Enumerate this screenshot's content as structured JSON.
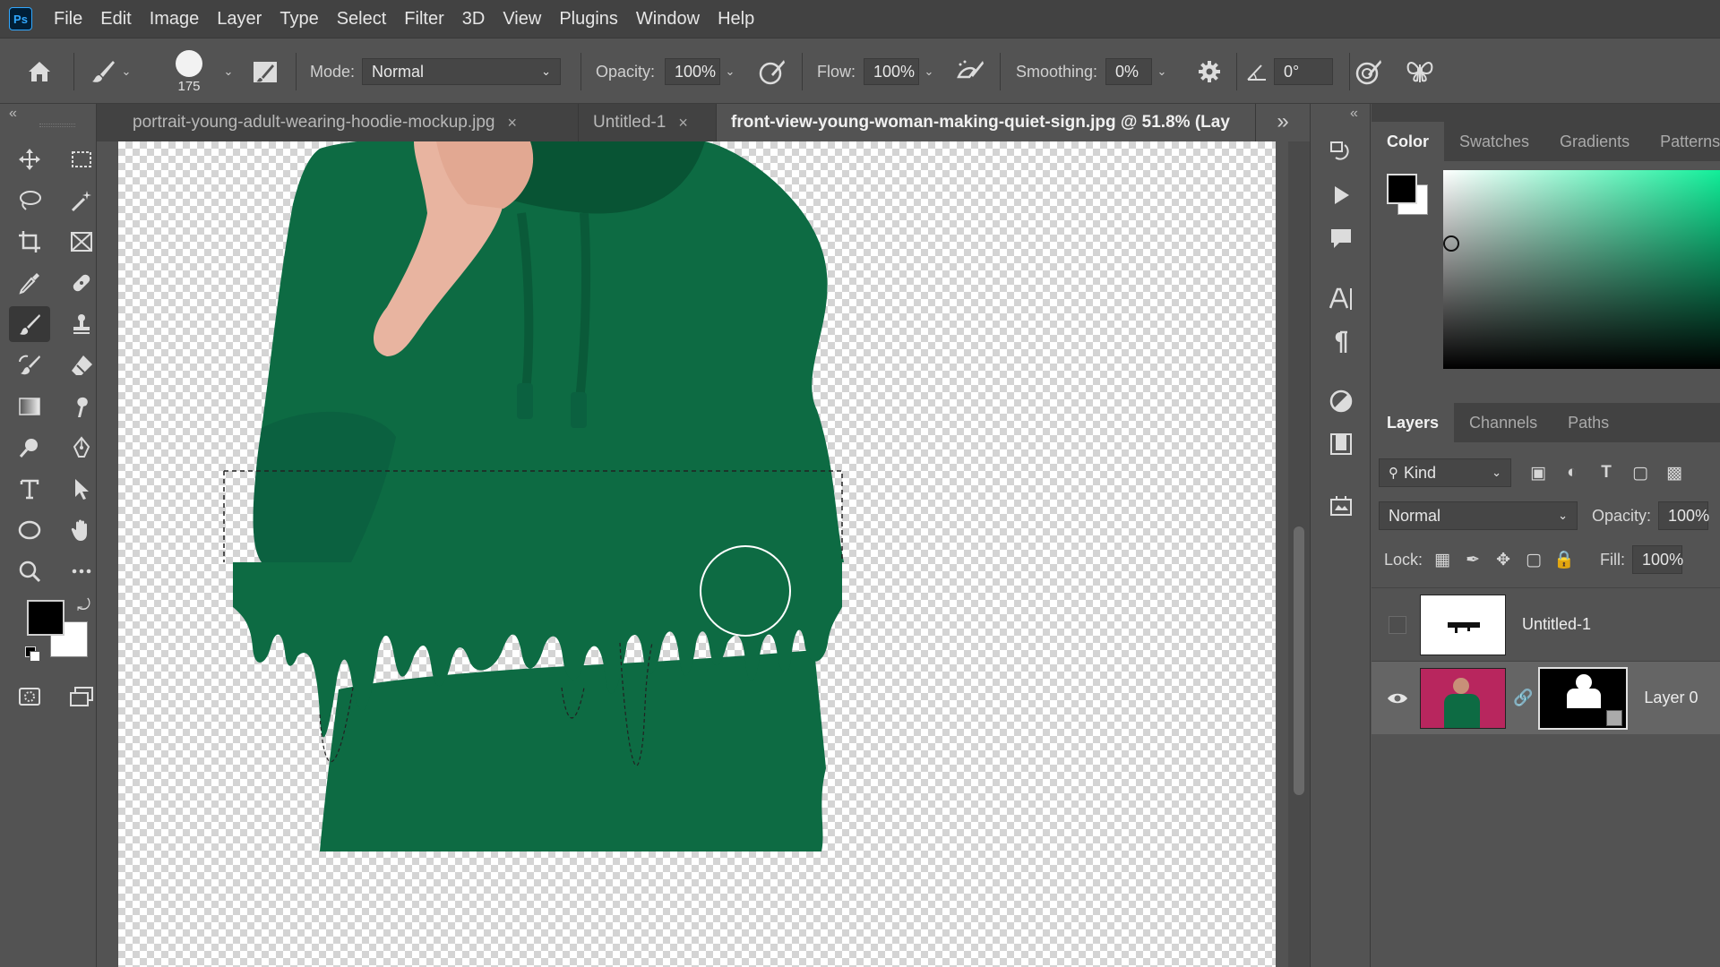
{
  "app": {
    "logo_text": "Ps"
  },
  "menu": [
    "File",
    "Edit",
    "Image",
    "Layer",
    "Type",
    "Select",
    "Filter",
    "3D",
    "View",
    "Plugins",
    "Window",
    "Help"
  ],
  "options": {
    "brush_size": "175",
    "mode_label": "Mode:",
    "mode_value": "Normal",
    "opacity_label": "Opacity:",
    "opacity_value": "100%",
    "flow_label": "Flow:",
    "flow_value": "100%",
    "smoothing_label": "Smoothing:",
    "smoothing_value": "0%",
    "angle_value": "0°"
  },
  "tabs": [
    {
      "label": "portrait-young-adult-wearing-hoodie-mockup.jpg",
      "close": "×"
    },
    {
      "label": "Untitled-1",
      "close": "×"
    },
    {
      "label": "front-view-young-woman-making-quiet-sign.jpg @ 51.8% (Lay",
      "close": ""
    }
  ],
  "tabs_overflow": "»",
  "collapse_left": "«",
  "collapse_right": "«",
  "color_panel": {
    "tabs": [
      "Color",
      "Swatches",
      "Gradients",
      "Patterns"
    ],
    "foreground": "#000000",
    "background": "#ffffff"
  },
  "layers_panel": {
    "tabs": [
      "Layers",
      "Channels",
      "Paths"
    ],
    "kind_label": "Kind",
    "blend_mode": "Normal",
    "opacity_label": "Opacity:",
    "opacity_value": "100%",
    "lock_label": "Lock:",
    "fill_label": "Fill:",
    "fill_value": "100%",
    "layers": [
      {
        "name": "Untitled-1",
        "visible": false
      },
      {
        "name": "Layer 0",
        "visible": true
      }
    ]
  },
  "colors": {
    "hoodie": "#0d6b43",
    "hoodie_dark": "#085434",
    "skin": "#e8b4a0",
    "accent": "#31a8ff"
  }
}
